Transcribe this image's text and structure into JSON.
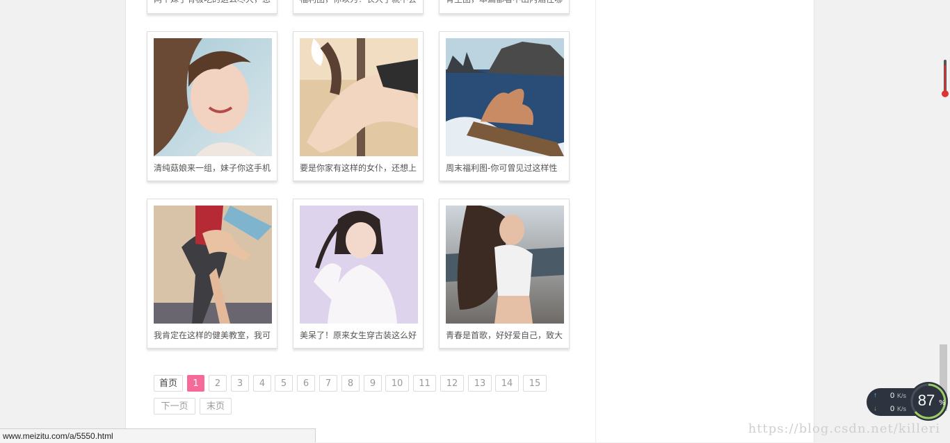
{
  "partial_row": {
    "captions": [
      "两个妹子有极吃的这么尽大，您",
      "福利图，你以为！长大了就不会",
      "青主图，本漏都看不出内涵往哪"
    ]
  },
  "gallery": {
    "items": [
      {
        "caption": "清纯菇娘来一组，妹子你这手机"
      },
      {
        "caption": "要是你家有这样的女仆，还想上"
      },
      {
        "caption": "周末福利图-你可曾见过这样性"
      },
      {
        "caption": "我肯定在这样的健美教室，我可"
      },
      {
        "caption": "美呆了！原来女生穿古装这么好"
      },
      {
        "caption": "青春是首歌，好好爱自己，致大"
      }
    ]
  },
  "pagination": {
    "first": "首页",
    "pages": [
      "1",
      "2",
      "3",
      "4",
      "5",
      "6",
      "7",
      "8",
      "9",
      "10",
      "11",
      "12",
      "13",
      "14",
      "15"
    ],
    "current": "1",
    "next": "下一页",
    "last": "末页"
  },
  "statusbar": {
    "url": "www.meizitu.com/a/5550.html"
  },
  "watermark": "https://blog.csdn.net/killeri",
  "netspeed": {
    "up": "0",
    "down": "0",
    "unit": "K/s"
  },
  "gauge": {
    "value": "87",
    "unit": "%"
  },
  "colors": {
    "accent": "#f46b9a",
    "background": "#f1f1f1"
  }
}
